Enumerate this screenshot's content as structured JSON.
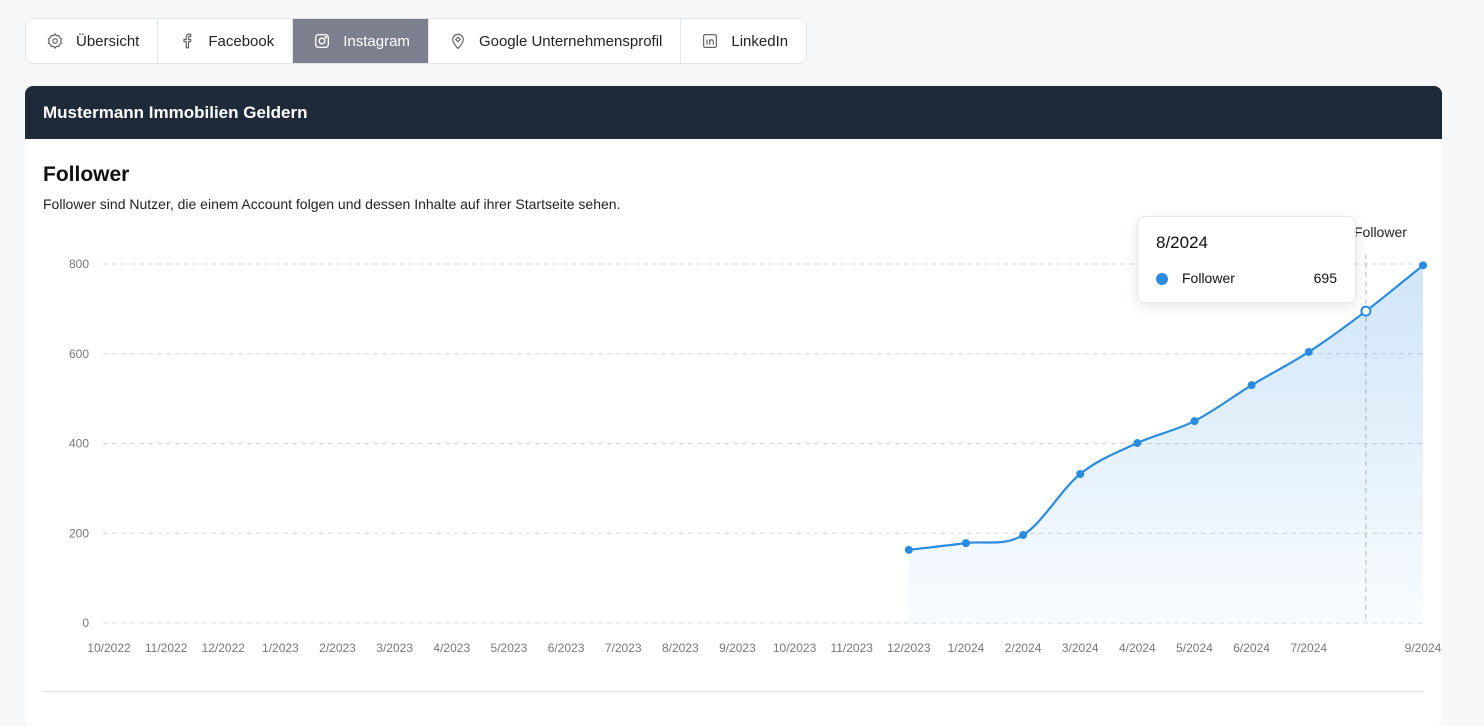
{
  "tabs": [
    {
      "label": "Übersicht",
      "icon": "gear-icon"
    },
    {
      "label": "Facebook",
      "icon": "facebook-icon"
    },
    {
      "label": "Instagram",
      "icon": "instagram-icon",
      "active": true
    },
    {
      "label": "Google Unternehmensprofil",
      "icon": "map-pin-icon"
    },
    {
      "label": "LinkedIn",
      "icon": "linkedin-icon"
    }
  ],
  "card": {
    "title": "Mustermann Immobilien Geldern"
  },
  "section": {
    "title": "Follower",
    "description": "Follower sind Nutzer, die einem Account folgen und dessen Inhalte auf ihrer Startseite sehen."
  },
  "tooltip": {
    "date": "8/2024",
    "series": "Follower",
    "value": "695"
  },
  "chart_data": {
    "type": "area",
    "categories": [
      "10/2022",
      "11/2022",
      "12/2022",
      "1/2023",
      "2/2023",
      "3/2023",
      "4/2023",
      "5/2023",
      "6/2023",
      "7/2023",
      "8/2023",
      "9/2023",
      "10/2023",
      "11/2023",
      "12/2023",
      "1/2024",
      "2/2024",
      "3/2024",
      "4/2024",
      "5/2024",
      "6/2024",
      "7/2024",
      "8/2024",
      "9/2024"
    ],
    "x_tick_labels": [
      "10/2022",
      "11/2022",
      "12/2022",
      "1/2023",
      "2/2023",
      "3/2023",
      "4/2023",
      "5/2023",
      "6/2023",
      "7/2023",
      "8/2023",
      "9/2023",
      "10/2023",
      "11/2023",
      "12/2023",
      "1/2024",
      "2/2024",
      "3/2024",
      "4/2024",
      "5/2024",
      "6/2024",
      "7/2024",
      "",
      "9/2024"
    ],
    "series": [
      {
        "name": "Follower",
        "color": "#2a8be0",
        "values": [
          null,
          null,
          null,
          null,
          null,
          null,
          null,
          null,
          null,
          null,
          null,
          null,
          null,
          null,
          163,
          178,
          196,
          332,
          401,
          450,
          530,
          604,
          695,
          797
        ]
      }
    ],
    "ylim": [
      0,
      800
    ],
    "yticks": [
      0,
      200,
      400,
      600,
      800
    ],
    "grid": true,
    "legend": "top-right",
    "highlighted": "8/2024"
  }
}
